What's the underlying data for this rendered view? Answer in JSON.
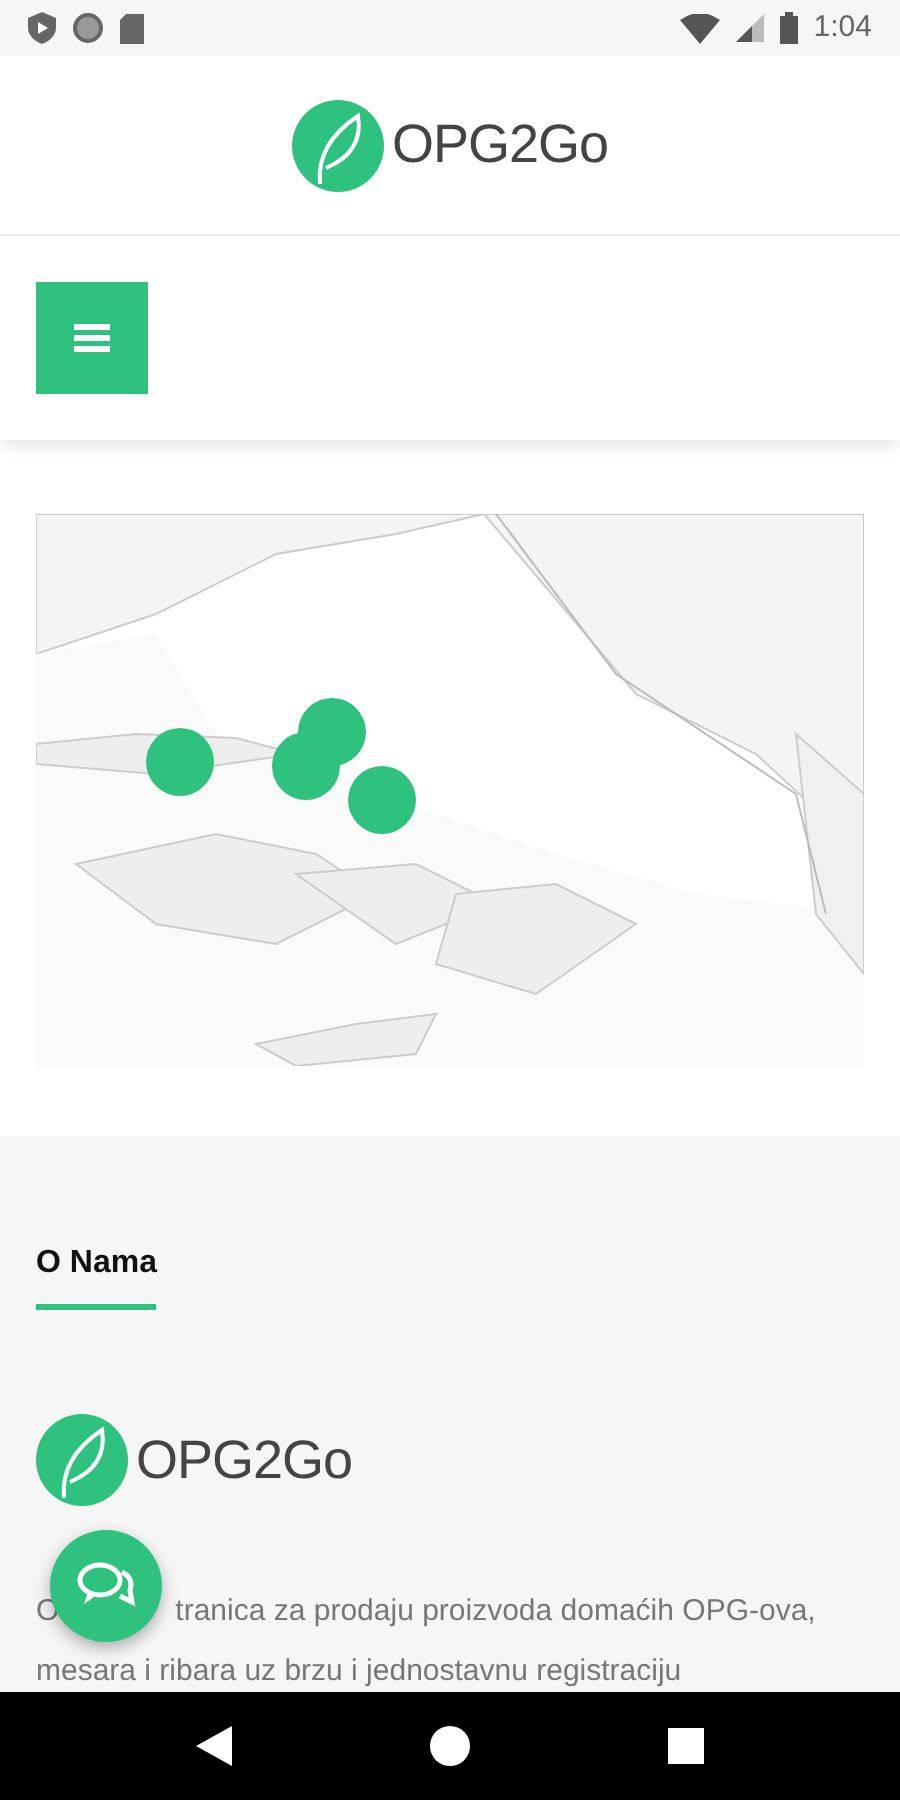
{
  "status_bar": {
    "time": "1:04"
  },
  "header": {
    "logo_text": "OPG2Go"
  },
  "about": {
    "title": "O Nama",
    "logo_text": "OPG2Go",
    "text_start": "O",
    "text_rest": "tranica za prodaju proizvoda domaćih OPG-ova,",
    "text_line_2": "mesara i ribara uz brzu i jednostavnu registraciju"
  }
}
